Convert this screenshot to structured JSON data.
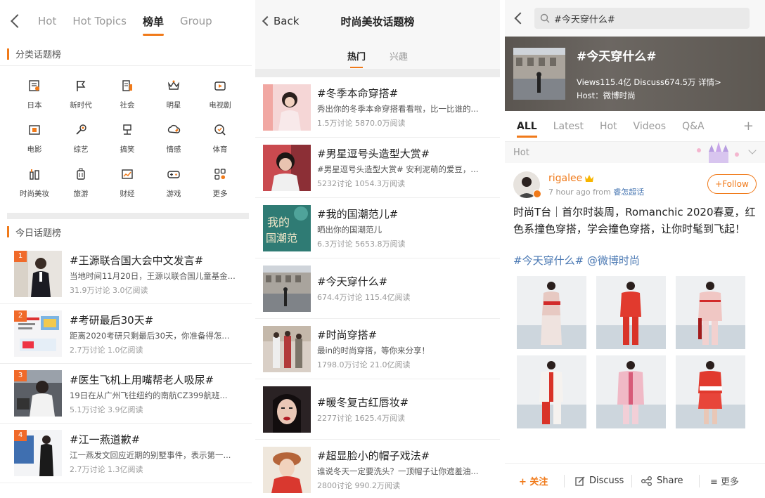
{
  "panel1": {
    "tabs": [
      "Hot",
      "Hot Topics",
      "榜单",
      "Group"
    ],
    "category_title": "分类话题榜",
    "categories": [
      {
        "label": "日本",
        "icon": "newspaper-icon"
      },
      {
        "label": "新时代",
        "icon": "flag-icon"
      },
      {
        "label": "社会",
        "icon": "building-icon"
      },
      {
        "label": "明星",
        "icon": "crown-icon"
      },
      {
        "label": "电视剧",
        "icon": "tv-icon"
      },
      {
        "label": "电影",
        "icon": "film-icon"
      },
      {
        "label": "综艺",
        "icon": "microphone-icon"
      },
      {
        "label": "搞笑",
        "icon": "podium-icon"
      },
      {
        "label": "情感",
        "icon": "heart-cloud-icon"
      },
      {
        "label": "体育",
        "icon": "ball-icon"
      },
      {
        "label": "时尚美妆",
        "icon": "cosmetics-icon"
      },
      {
        "label": "旅游",
        "icon": "luggage-icon"
      },
      {
        "label": "财经",
        "icon": "stock-chart-icon"
      },
      {
        "label": "游戏",
        "icon": "gamepad-icon"
      },
      {
        "label": "更多",
        "icon": "grid-icon"
      }
    ],
    "today_title": "今日话题榜",
    "ranks": [
      {
        "rank": "1",
        "title": "#王源联合国大会中文发言#",
        "desc": "当地时间11月20日，王源以联合国儿童基金...",
        "stats": "31.9万讨论 3.0亿阅读"
      },
      {
        "rank": "2",
        "title": "#考研最后30天#",
        "desc": "距离2020考研只剩最后30天，你准备得怎...",
        "stats": "2.7万讨论 1.0亿阅读"
      },
      {
        "rank": "3",
        "title": "#医生飞机上用嘴帮老人吸尿#",
        "desc": "19日在从广州飞往纽约的南航CZ399航班...",
        "stats": "5.1万讨论 3.9亿阅读"
      },
      {
        "rank": "4",
        "title": "#江一燕道歉#",
        "desc": "江一燕发文回应近期的别墅事件，表示第一...",
        "stats": "2.7万讨论 1.3亿阅读"
      }
    ]
  },
  "panel2": {
    "back_label": "Back",
    "title": "时尚美妆话题榜",
    "tabs": [
      "热门",
      "兴趣"
    ],
    "topics": [
      {
        "title": "#冬季本命穿搭#",
        "desc": "秀出你的冬季本命穿搭看看啦，比一比谁的...",
        "stats": "1.5万讨论 5870.0万阅读"
      },
      {
        "title": "#男星逗号头造型大赏#",
        "desc": "#男星逗号头造型大赏# 安利泥萌的爱豆，...",
        "stats": "5232讨论 1054.3万阅读"
      },
      {
        "title": "#我的国潮范儿#",
        "desc": "晒出你的国潮范儿",
        "stats": "6.3万讨论 5653.8万阅读"
      },
      {
        "title": "#今天穿什么#",
        "desc": "",
        "stats": "674.4万讨论 115.4亿阅读"
      },
      {
        "title": "#时尚穿搭#",
        "desc": "最in的时尚穿搭，等你来分享！",
        "stats": "1798.0万讨论 21.0亿阅读"
      },
      {
        "title": "#暖冬复古红唇妆#",
        "desc": "",
        "stats": "2277讨论 1625.4万阅读"
      },
      {
        "title": "#超显脸小的帽子戏法#",
        "desc": "谁说冬天一定要洗头？一顶帽子让你遮羞油...",
        "stats": "2800讨论 990.2万阅读"
      }
    ],
    "thumb_text": "我的国潮范儿"
  },
  "panel3": {
    "search_text": "#今天穿什么#",
    "banner": {
      "title": "#今天穿什么#",
      "stats": "Views115.4亿  Discuss674.5万  详情>",
      "host": "Host：微博时尚"
    },
    "tabs": [
      "ALL",
      "Latest",
      "Hot",
      "Videos",
      "Q&A"
    ],
    "plus": "+",
    "hot_label": "Hot",
    "post": {
      "user": "rigalee",
      "time": "7 hour ago",
      "from_label": "from",
      "via": "睿怎超话",
      "follow_label": "+Follow",
      "text": "时尚T台｜首尔时装周，Romanchic 2020春夏，红色系撞色穿搭，学会撞色穿搭，让你时髦到飞起！",
      "tags": "#今天穿什么# @微博时尚"
    },
    "bottom": {
      "follow": "+ 关注",
      "discuss": "Discuss",
      "share": "Share",
      "more": "≡ 更多"
    },
    "colors": {
      "accent": "#f07a1a",
      "link": "#4a78b3"
    }
  }
}
